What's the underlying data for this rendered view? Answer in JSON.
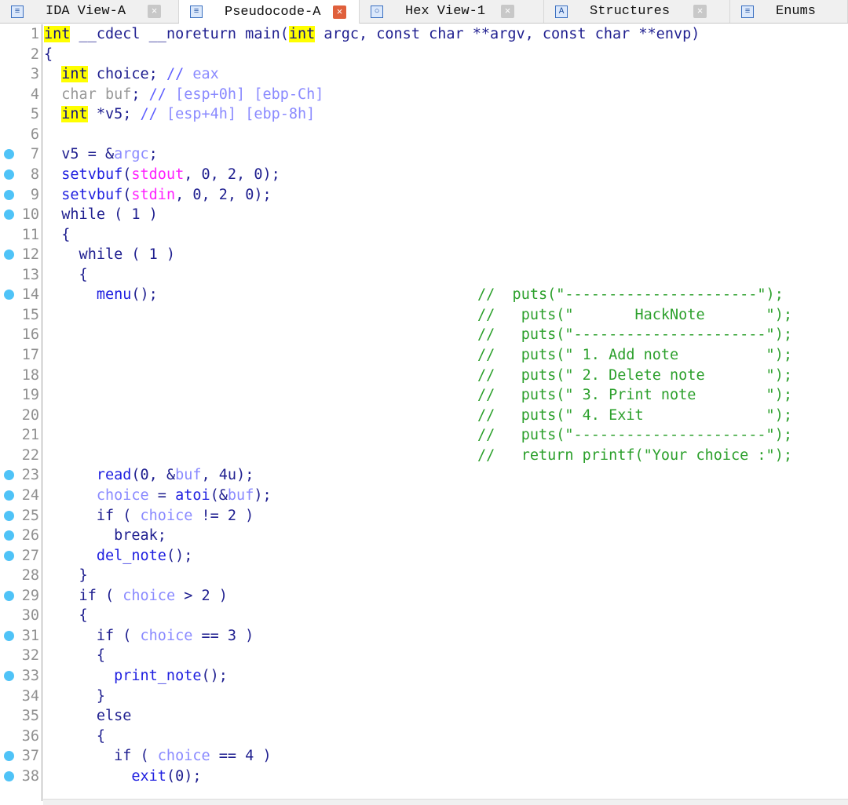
{
  "tabs": [
    {
      "label": "IDA View-A",
      "icon": "disassembly-icon",
      "active": false
    },
    {
      "label": "Pseudocode-A",
      "icon": "pseudocode-icon",
      "active": true
    },
    {
      "label": "Hex View-1",
      "icon": "hex-icon",
      "active": false
    },
    {
      "label": "Structures",
      "icon": "structures-icon",
      "active": false
    },
    {
      "label": "Enums",
      "icon": "enums-icon",
      "active": false
    }
  ],
  "lines": [
    {
      "n": "1",
      "bp": false,
      "t": [
        [
          "int",
          "k"
        ],
        [
          " __cdecl __noreturn main(",
          "n"
        ],
        [
          "int",
          "k"
        ],
        [
          " argc, const char **argv, const char **envp)",
          "n"
        ]
      ]
    },
    {
      "n": "2",
      "bp": false,
      "t": [
        [
          "{",
          "n"
        ]
      ]
    },
    {
      "n": "3",
      "bp": false,
      "t": [
        [
          "  ",
          "n"
        ],
        [
          "int",
          "k"
        ],
        [
          " choice; ",
          "n"
        ],
        [
          "// ",
          "c"
        ],
        [
          "eax",
          "v"
        ]
      ]
    },
    {
      "n": "4",
      "bp": false,
      "t": [
        [
          "  char buf",
          "u"
        ],
        [
          "; ",
          "n"
        ],
        [
          "// ",
          "c"
        ],
        [
          "[esp+0h] [ebp-Ch]",
          "v"
        ]
      ]
    },
    {
      "n": "5",
      "bp": false,
      "t": [
        [
          "  ",
          "n"
        ],
        [
          "int",
          "k"
        ],
        [
          " *v5; ",
          "n"
        ],
        [
          "// ",
          "c"
        ],
        [
          "[esp+4h] [ebp-8h]",
          "v"
        ]
      ]
    },
    {
      "n": "6",
      "bp": false,
      "t": []
    },
    {
      "n": "7",
      "bp": true,
      "t": [
        [
          "  v5 = &",
          "n"
        ],
        [
          "argc",
          "v"
        ],
        [
          ";",
          "n"
        ]
      ]
    },
    {
      "n": "8",
      "bp": true,
      "t": [
        [
          "  ",
          "n"
        ],
        [
          "setvbuf",
          "f"
        ],
        [
          "(",
          "n"
        ],
        [
          "stdout",
          "g"
        ],
        [
          ", 0, 2, 0);",
          "n"
        ]
      ]
    },
    {
      "n": "9",
      "bp": true,
      "t": [
        [
          "  ",
          "n"
        ],
        [
          "setvbuf",
          "f"
        ],
        [
          "(",
          "n"
        ],
        [
          "stdin",
          "g"
        ],
        [
          ", 0, 2, 0);",
          "n"
        ]
      ]
    },
    {
      "n": "10",
      "bp": true,
      "t": [
        [
          "  while ( 1 )",
          "n"
        ]
      ]
    },
    {
      "n": "11",
      "bp": false,
      "t": [
        [
          "  {",
          "n"
        ]
      ]
    },
    {
      "n": "12",
      "bp": true,
      "t": [
        [
          "    while ( 1 )",
          "n"
        ]
      ]
    },
    {
      "n": "13",
      "bp": false,
      "t": [
        [
          "    {",
          "n"
        ]
      ]
    },
    {
      "n": "14",
      "bp": true,
      "t": [
        [
          "      ",
          "n"
        ],
        [
          "menu",
          "f"
        ],
        [
          "();",
          "n"
        ]
      ],
      "cm": "//  puts(\"----------------------\");"
    },
    {
      "n": "15",
      "bp": false,
      "t": [],
      "cm": "//   puts(\"       HackNote       \");"
    },
    {
      "n": "16",
      "bp": false,
      "t": [],
      "cm": "//   puts(\"----------------------\");"
    },
    {
      "n": "17",
      "bp": false,
      "t": [],
      "cm": "//   puts(\" 1. Add note          \");"
    },
    {
      "n": "18",
      "bp": false,
      "t": [],
      "cm": "//   puts(\" 2. Delete note       \");"
    },
    {
      "n": "19",
      "bp": false,
      "t": [],
      "cm": "//   puts(\" 3. Print note        \");"
    },
    {
      "n": "20",
      "bp": false,
      "t": [],
      "cm": "//   puts(\" 4. Exit              \");"
    },
    {
      "n": "21",
      "bp": false,
      "t": [],
      "cm": "//   puts(\"----------------------\");"
    },
    {
      "n": "22",
      "bp": false,
      "t": [],
      "cm": "//   return printf(\"Your choice :\");"
    },
    {
      "n": "23",
      "bp": true,
      "t": [
        [
          "      ",
          "n"
        ],
        [
          "read",
          "f"
        ],
        [
          "(0, &",
          "n"
        ],
        [
          "buf",
          "v"
        ],
        [
          ", 4u);",
          "n"
        ]
      ]
    },
    {
      "n": "24",
      "bp": true,
      "t": [
        [
          "      ",
          "n"
        ],
        [
          "choice",
          "v"
        ],
        [
          " = ",
          "n"
        ],
        [
          "atoi",
          "f"
        ],
        [
          "(&",
          "n"
        ],
        [
          "buf",
          "v"
        ],
        [
          ");",
          "n"
        ]
      ]
    },
    {
      "n": "25",
      "bp": true,
      "t": [
        [
          "      if ( ",
          "n"
        ],
        [
          "choice",
          "v"
        ],
        [
          " != 2 )",
          "n"
        ]
      ]
    },
    {
      "n": "26",
      "bp": true,
      "t": [
        [
          "        break;",
          "n"
        ]
      ]
    },
    {
      "n": "27",
      "bp": true,
      "t": [
        [
          "      ",
          "n"
        ],
        [
          "del_note",
          "f"
        ],
        [
          "();",
          "n"
        ]
      ]
    },
    {
      "n": "28",
      "bp": false,
      "t": [
        [
          "    }",
          "n"
        ]
      ]
    },
    {
      "n": "29",
      "bp": true,
      "t": [
        [
          "    if ( ",
          "n"
        ],
        [
          "choice",
          "v"
        ],
        [
          " > 2 )",
          "n"
        ]
      ]
    },
    {
      "n": "30",
      "bp": false,
      "t": [
        [
          "    {",
          "n"
        ]
      ]
    },
    {
      "n": "31",
      "bp": true,
      "t": [
        [
          "      if ( ",
          "n"
        ],
        [
          "choice",
          "v"
        ],
        [
          " == 3 )",
          "n"
        ]
      ]
    },
    {
      "n": "32",
      "bp": false,
      "t": [
        [
          "      {",
          "n"
        ]
      ]
    },
    {
      "n": "33",
      "bp": true,
      "t": [
        [
          "        ",
          "n"
        ],
        [
          "print_note",
          "f"
        ],
        [
          "();",
          "n"
        ]
      ]
    },
    {
      "n": "34",
      "bp": false,
      "t": [
        [
          "      }",
          "n"
        ]
      ]
    },
    {
      "n": "35",
      "bp": false,
      "t": [
        [
          "      else",
          "n"
        ]
      ]
    },
    {
      "n": "36",
      "bp": false,
      "t": [
        [
          "      {",
          "n"
        ]
      ]
    },
    {
      "n": "37",
      "bp": true,
      "t": [
        [
          "        if ( ",
          "n"
        ],
        [
          "choice",
          "v"
        ],
        [
          " == 4 )",
          "n"
        ]
      ]
    },
    {
      "n": "38",
      "bp": true,
      "t": [
        [
          "          ",
          "n"
        ],
        [
          "exit",
          "f"
        ],
        [
          "(0);",
          "n"
        ]
      ]
    }
  ]
}
